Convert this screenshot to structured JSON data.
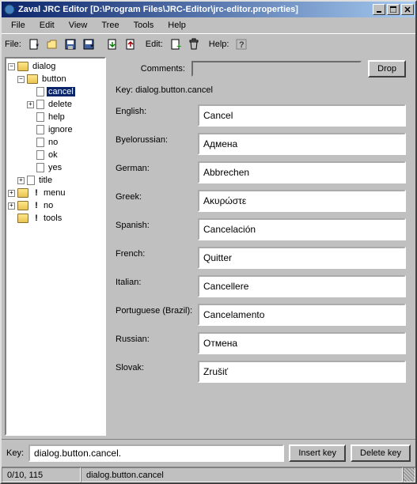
{
  "window": {
    "title": "Zaval JRC Editor [D:\\Program Files\\JRC-Editor\\jrc-editor.properties]"
  },
  "menu": {
    "file": "File",
    "edit": "Edit",
    "view": "View",
    "tree": "Tree",
    "tools": "Tools",
    "help": "Help"
  },
  "toolbar": {
    "file_label": "File:",
    "edit_label": "Edit:",
    "help_label": "Help:"
  },
  "tree": {
    "dialog": "dialog",
    "button": "button",
    "cancel": "cancel",
    "delete": "delete",
    "help": "help",
    "ignore": "ignore",
    "no": "no",
    "ok": "ok",
    "yes": "yes",
    "title": "title",
    "menu": "menu",
    "no2": "no",
    "tools": "tools"
  },
  "content": {
    "comments_label": "Comments:",
    "comments_value": "",
    "drop_btn": "Drop",
    "key_label": "Key: dialog.button.cancel",
    "languages": [
      {
        "label": "English:",
        "value": "Cancel"
      },
      {
        "label": "Byelorussian:",
        "value": "Адмена"
      },
      {
        "label": "German:",
        "value": "Abbrechen"
      },
      {
        "label": "Greek:",
        "value": "Ακυρώστε"
      },
      {
        "label": "Spanish:",
        "value": "Cancelación"
      },
      {
        "label": "French:",
        "value": "Quitter"
      },
      {
        "label": "Italian:",
        "value": "Cancellere"
      },
      {
        "label": "Portuguese (Brazil):",
        "value": "Cancelamento"
      },
      {
        "label": "Russian:",
        "value": "Отмена"
      },
      {
        "label": "Slovak:",
        "value": "Zrušiť"
      }
    ]
  },
  "key_row": {
    "label": "Key:",
    "value": "dialog.button.cancel.",
    "insert_btn": "Insert key",
    "delete_btn": "Delete key"
  },
  "status": {
    "left": "0/10, 115",
    "right": "dialog.button.cancel"
  }
}
